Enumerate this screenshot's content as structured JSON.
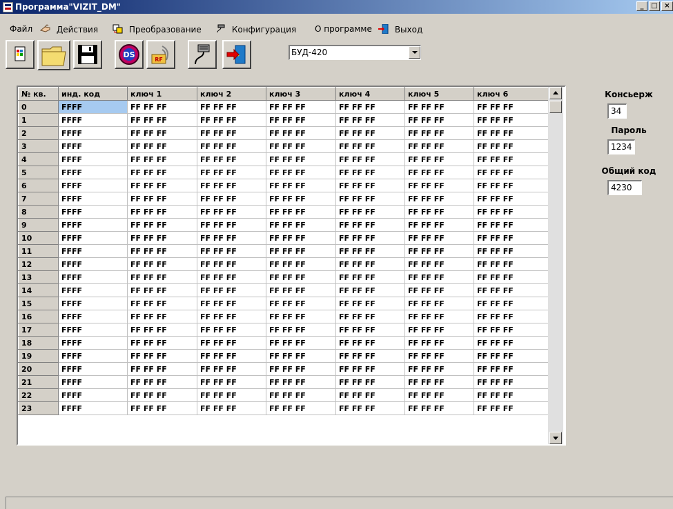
{
  "window": {
    "title": "Программа\"VIZIT_DM\"",
    "controls": [
      "_",
      "□",
      "×"
    ]
  },
  "menu": [
    {
      "label": "Файл",
      "icon": null
    },
    {
      "label": "Действия",
      "icon": "hand-icon"
    },
    {
      "label": "Преобразование",
      "icon": "convert-icon"
    },
    {
      "label": "Конфигурация",
      "icon": "connector-icon"
    },
    {
      "label": "О программе",
      "icon": null
    },
    {
      "label": "Выход",
      "icon": "exit-door-icon"
    }
  ],
  "toolbar": {
    "buttons": [
      "print-icon",
      "open-folder-icon",
      "save-disk-icon",
      "ds-key-icon",
      "rf-card-icon",
      "connector-plug-icon",
      "exit-door-icon"
    ],
    "device_select": {
      "value": "БУД-420"
    }
  },
  "grid": {
    "headers": [
      "№ кв.",
      "инд. код",
      "ключ 1",
      "ключ 2",
      "ключ 3",
      "ключ 4",
      "ключ 5",
      "ключ 6"
    ],
    "rows": [
      [
        "0",
        "FFFF",
        "FF FF FF",
        "FF FF FF",
        "FF FF FF",
        "FF FF FF",
        "FF FF FF",
        "FF FF FF"
      ],
      [
        "1",
        "FFFF",
        "FF FF FF",
        "FF FF FF",
        "FF FF FF",
        "FF FF FF",
        "FF FF FF",
        "FF FF FF"
      ],
      [
        "2",
        "FFFF",
        "FF FF FF",
        "FF FF FF",
        "FF FF FF",
        "FF FF FF",
        "FF FF FF",
        "FF FF FF"
      ],
      [
        "3",
        "FFFF",
        "FF FF FF",
        "FF FF FF",
        "FF FF FF",
        "FF FF FF",
        "FF FF FF",
        "FF FF FF"
      ],
      [
        "4",
        "FFFF",
        "FF FF FF",
        "FF FF FF",
        "FF FF FF",
        "FF FF FF",
        "FF FF FF",
        "FF FF FF"
      ],
      [
        "5",
        "FFFF",
        "FF FF FF",
        "FF FF FF",
        "FF FF FF",
        "FF FF FF",
        "FF FF FF",
        "FF FF FF"
      ],
      [
        "6",
        "FFFF",
        "FF FF FF",
        "FF FF FF",
        "FF FF FF",
        "FF FF FF",
        "FF FF FF",
        "FF FF FF"
      ],
      [
        "7",
        "FFFF",
        "FF FF FF",
        "FF FF FF",
        "FF FF FF",
        "FF FF FF",
        "FF FF FF",
        "FF FF FF"
      ],
      [
        "8",
        "FFFF",
        "FF FF FF",
        "FF FF FF",
        "FF FF FF",
        "FF FF FF",
        "FF FF FF",
        "FF FF FF"
      ],
      [
        "9",
        "FFFF",
        "FF FF FF",
        "FF FF FF",
        "FF FF FF",
        "FF FF FF",
        "FF FF FF",
        "FF FF FF"
      ],
      [
        "10",
        "FFFF",
        "FF FF FF",
        "FF FF FF",
        "FF FF FF",
        "FF FF FF",
        "FF FF FF",
        "FF FF FF"
      ],
      [
        "11",
        "FFFF",
        "FF FF FF",
        "FF FF FF",
        "FF FF FF",
        "FF FF FF",
        "FF FF FF",
        "FF FF FF"
      ],
      [
        "12",
        "FFFF",
        "FF FF FF",
        "FF FF FF",
        "FF FF FF",
        "FF FF FF",
        "FF FF FF",
        "FF FF FF"
      ],
      [
        "13",
        "FFFF",
        "FF FF FF",
        "FF FF FF",
        "FF FF FF",
        "FF FF FF",
        "FF FF FF",
        "FF FF FF"
      ],
      [
        "14",
        "FFFF",
        "FF FF FF",
        "FF FF FF",
        "FF FF FF",
        "FF FF FF",
        "FF FF FF",
        "FF FF FF"
      ],
      [
        "15",
        "FFFF",
        "FF FF FF",
        "FF FF FF",
        "FF FF FF",
        "FF FF FF",
        "FF FF FF",
        "FF FF FF"
      ],
      [
        "16",
        "FFFF",
        "FF FF FF",
        "FF FF FF",
        "FF FF FF",
        "FF FF FF",
        "FF FF FF",
        "FF FF FF"
      ],
      [
        "17",
        "FFFF",
        "FF FF FF",
        "FF FF FF",
        "FF FF FF",
        "FF FF FF",
        "FF FF FF",
        "FF FF FF"
      ],
      [
        "18",
        "FFFF",
        "FF FF FF",
        "FF FF FF",
        "FF FF FF",
        "FF FF FF",
        "FF FF FF",
        "FF FF FF"
      ],
      [
        "19",
        "FFFF",
        "FF FF FF",
        "FF FF FF",
        "FF FF FF",
        "FF FF FF",
        "FF FF FF",
        "FF FF FF"
      ],
      [
        "20",
        "FFFF",
        "FF FF FF",
        "FF FF FF",
        "FF FF FF",
        "FF FF FF",
        "FF FF FF",
        "FF FF FF"
      ],
      [
        "21",
        "FFFF",
        "FF FF FF",
        "FF FF FF",
        "FF FF FF",
        "FF FF FF",
        "FF FF FF",
        "FF FF FF"
      ],
      [
        "22",
        "FFFF",
        "FF FF FF",
        "FF FF FF",
        "FF FF FF",
        "FF FF FF",
        "FF FF FF",
        "FF FF FF"
      ],
      [
        "23",
        "FFFF",
        "FF FF FF",
        "FF FF FF",
        "FF FF FF",
        "FF FF FF",
        "FF FF FF",
        "FF FF FF"
      ]
    ],
    "selected": {
      "row": 0,
      "col": 1
    }
  },
  "side": {
    "concierge_label": "Консьерж",
    "concierge_value": "34",
    "password_label": "Пароль",
    "password_value": "1234",
    "common_code_label": "Общий код",
    "common_code_value": "4230"
  },
  "colors": {
    "selection": "#a6caf0",
    "title_bar": "#0a246a",
    "face": "#d4d0c8"
  }
}
